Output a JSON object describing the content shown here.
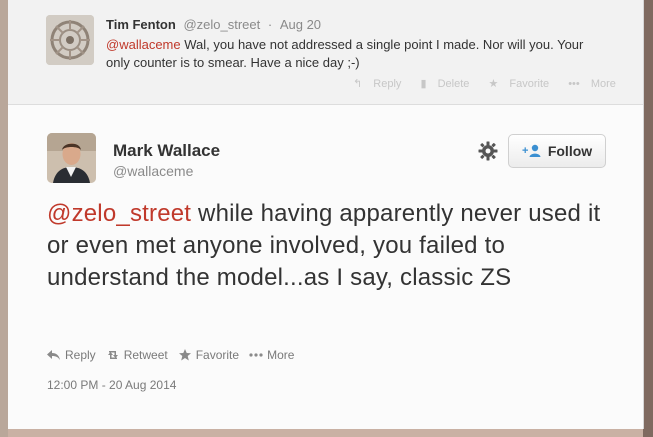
{
  "reply_tweet": {
    "author_name": "Tim Fenton",
    "handle": "@zelo_street",
    "date": "Aug 20",
    "mention": "@wallaceme",
    "text": " Wal, you have not addressed a single point I made. Nor will you. Your only counter is to smear. Have a nice day ;-)",
    "actions": {
      "reply": "Reply",
      "delete": "Delete",
      "favorite": "Favorite",
      "more": "More"
    }
  },
  "main_tweet": {
    "author_name": "Mark Wallace",
    "handle": "@wallaceme",
    "follow_label": "Follow",
    "mention": "@zelo_street",
    "text": " while having apparently never used it or even met anyone involved, you failed to understand the model...as I say, classic ZS",
    "actions": {
      "reply": "Reply",
      "retweet": "Retweet",
      "favorite": "Favorite",
      "more": "More"
    },
    "timestamp": "12:00 PM - 20 Aug 2014"
  },
  "colors": {
    "mention": "#c0392b",
    "text": "#333333",
    "muted": "#8a8a8a"
  }
}
